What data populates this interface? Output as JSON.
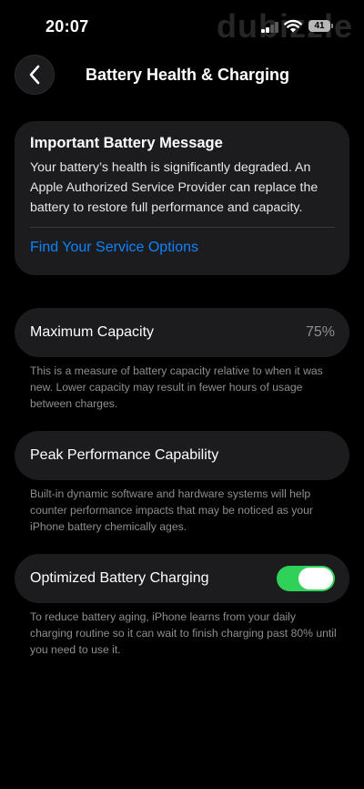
{
  "status_bar": {
    "time": "20:07",
    "battery_level": "41",
    "icons": [
      "cellular-signal-icon",
      "wifi-icon",
      "battery-icon"
    ]
  },
  "watermark": {
    "text": "dubizzle"
  },
  "nav": {
    "title": "Battery Health & Charging",
    "back_icon": "chevron-left-icon"
  },
  "message": {
    "title": "Important Battery Message",
    "body": "Your battery’s health is significantly degraded. An Apple Authorized Service Provider can replace the battery to restore full performance and capacity.",
    "link": "Find Your Service Options"
  },
  "max_capacity": {
    "label": "Maximum Capacity",
    "value": "75%",
    "footnote": "This is a measure of battery capacity relative to when it was new. Lower capacity may result in fewer hours of usage between charges."
  },
  "peak_performance": {
    "label": "Peak Performance Capability",
    "footnote": "Built-in dynamic software and hardware systems will help counter performance impacts that may be noticed as your iPhone battery chemically ages."
  },
  "optimized_charging": {
    "label": "Optimized Battery Charging",
    "enabled": true,
    "footnote": "To reduce battery aging, iPhone learns from your daily charging routine so it can wait to finish charging past 80% until you need to use it."
  },
  "colors": {
    "background": "#000000",
    "card": "#1c1c1e",
    "link": "#0a84ff",
    "toggle_on": "#30d158",
    "secondary_text": "#8e8e93"
  }
}
